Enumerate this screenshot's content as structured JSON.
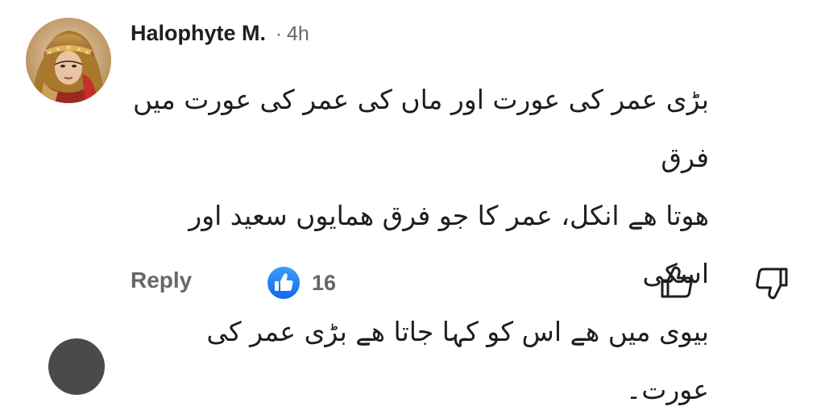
{
  "comment": {
    "author": "Halophyte M.",
    "separator": "·",
    "time": "4h",
    "lines": [
      "بڑی عمر کی عورت اور ماں کی عمر کی عورت میں فرق",
      "ھوتا ھے انکل، عمر کا جو فرق ھمایوں سعید اور اسکی",
      "بیوی میں ھے اس کو کہا جاتا ھے بڑی عمر کی عورت۔"
    ]
  },
  "actions": {
    "reply_label": "Reply",
    "reaction_count": "16",
    "reaction_icon": "like-icon",
    "upvote_icon": "thumbs-up-icon",
    "downvote_icon": "thumbs-down-icon"
  },
  "colors": {
    "text": "#1c1e21",
    "secondary": "#65676b",
    "like_blue": "#1877f2"
  }
}
